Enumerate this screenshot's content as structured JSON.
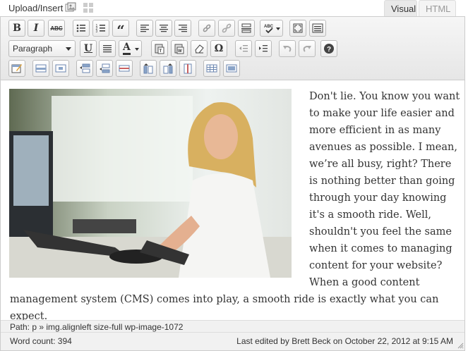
{
  "header": {
    "upload_label": "Upload/Insert",
    "tabs": [
      "Visual",
      "HTML"
    ]
  },
  "toolbar": {
    "format_value": "Paragraph",
    "bold": "B",
    "italic": "I",
    "strike": "ABC",
    "quote": "“",
    "underline": "U",
    "text_color": "A",
    "omega": "Ω",
    "spellcheck": "ABC"
  },
  "content": {
    "lines_right": [
      "Don't lie. You know you want",
      "to make your life easier and",
      "more efficient in as many",
      "avenues as possible. I mean,",
      "we’re all busy, right? There",
      "is nothing better than going",
      "through your day knowing",
      "it's a smooth ride. Well,",
      "shouldn't you feel the same",
      "when it comes to managing",
      "content for your website?",
      "When a good content"
    ],
    "lines_full": [
      "management system (CMS) comes into play, a smooth ride is exactly what you can",
      "expect."
    ]
  },
  "status": {
    "path": "Path: p » img.alignleft size-full wp-image-1072",
    "word_count": "Word count: 394",
    "last_edited": "Last edited by Brett Beck on October 22, 2012 at 9:15 AM"
  },
  "colors": {
    "toolbar_bg": "#ececec",
    "status_bg": "#f1f1f1",
    "text": "#333333"
  }
}
